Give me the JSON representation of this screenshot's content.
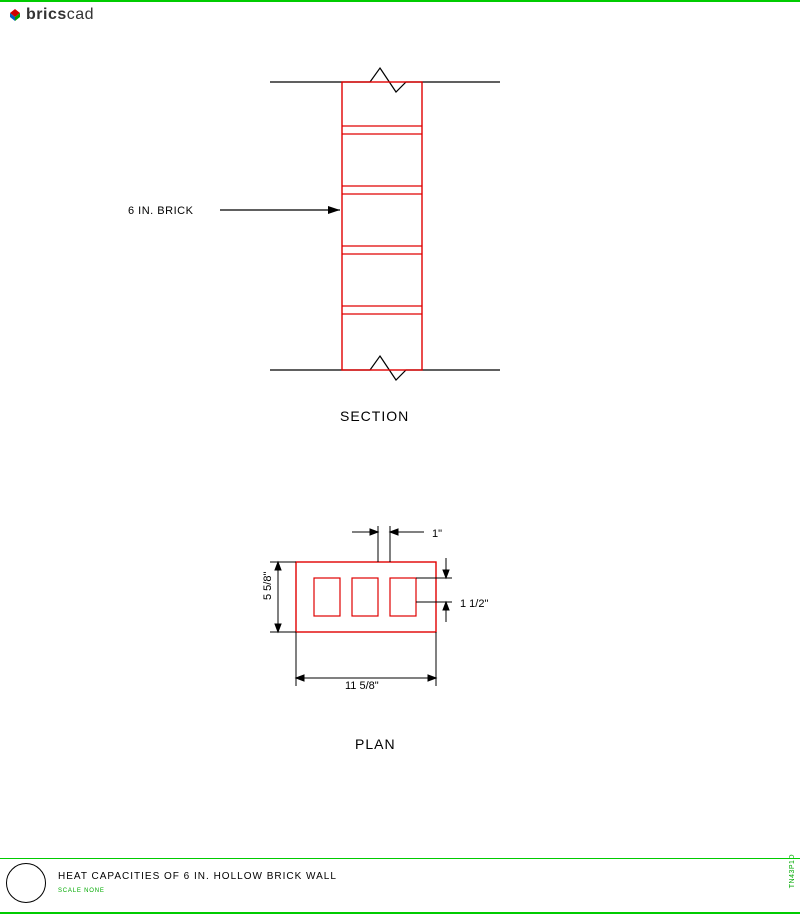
{
  "header": {
    "brand": "bricscad"
  },
  "section": {
    "label_brick": "6 IN. BRICK",
    "caption": "SECTION"
  },
  "plan": {
    "dim_1": "1\"",
    "dim_1_half": "1 1/2\"",
    "dim_height": "5 5/8\"",
    "dim_width": "11 5/8\"",
    "caption": "PLAN"
  },
  "title_block": {
    "title": "HEAT CAPACITIES OF 6 IN. HOLLOW BRICK WALL",
    "scale": "SCALE NONE"
  },
  "watermark": "TN43P1D"
}
